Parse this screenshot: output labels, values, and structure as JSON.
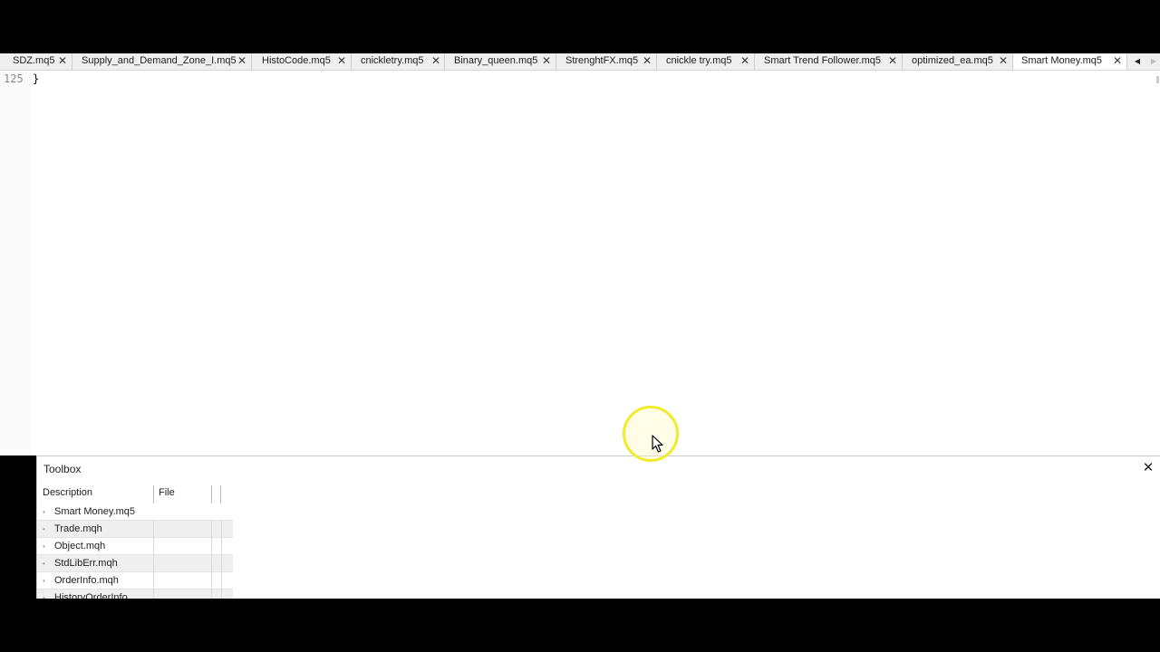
{
  "tabs": [
    {
      "label": "SDZ.mq5",
      "active": false
    },
    {
      "label": "Supply_and_Demand_Zone_I.mq5",
      "active": false
    },
    {
      "label": "HistoCode.mq5",
      "active": false
    },
    {
      "label": "cnickletry.mq5",
      "active": false
    },
    {
      "label": "Binary_queen.mq5",
      "active": false
    },
    {
      "label": "StrenghtFX.mq5",
      "active": false
    },
    {
      "label": "cnickle try.mq5",
      "active": false
    },
    {
      "label": "Smart Trend Follower.mq5",
      "active": false
    },
    {
      "label": "optimized_ea.mq5",
      "active": false
    },
    {
      "label": "Smart Money.mq5",
      "active": true
    }
  ],
  "tab_close_glyph": "✕",
  "tab_scroll": {
    "left_glyph": "◀",
    "right_glyph": "▶"
  },
  "editor": {
    "line_number": "125",
    "line_text": "}"
  },
  "toolbox": {
    "title": "Toolbox",
    "close_glyph": "✕",
    "columns": [
      "Description",
      "File"
    ],
    "rows": [
      {
        "description": "Smart Money.mq5",
        "file": ""
      },
      {
        "description": "Trade.mqh",
        "file": ""
      },
      {
        "description": "Object.mqh",
        "file": ""
      },
      {
        "description": "StdLibErr.mqh",
        "file": ""
      },
      {
        "description": "OrderInfo.mqh",
        "file": ""
      },
      {
        "description": "HistoryOrderInfo...",
        "file": ""
      }
    ],
    "bullet_glyph": "•"
  },
  "colors": {
    "highlight_ring": "#f2ea2a",
    "background": "#000000",
    "editor_bg": "#ffffff",
    "tabbar_bg": "#efefef"
  },
  "icons": {
    "tab_close": "close-icon",
    "toolbox_close": "close-icon",
    "mouse": "arrow-cursor-icon"
  }
}
